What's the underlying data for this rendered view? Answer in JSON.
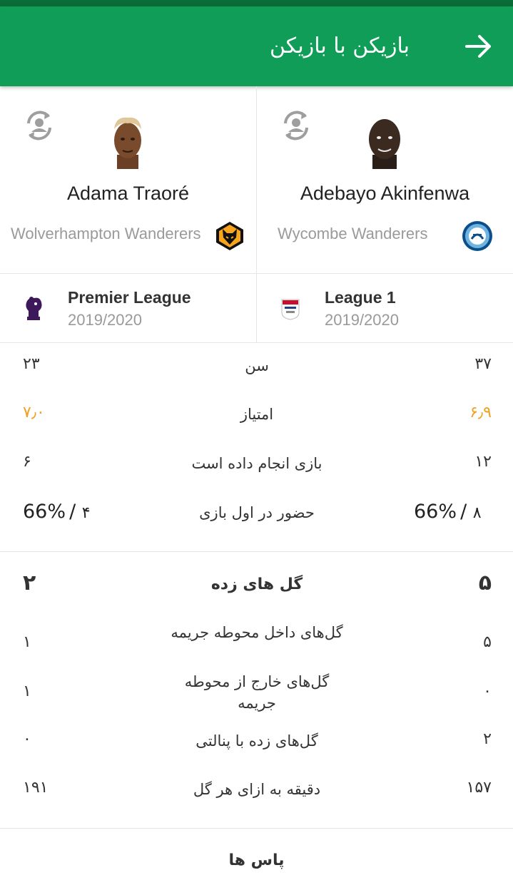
{
  "header": {
    "title": "بازیکن با بازیکن"
  },
  "players": {
    "left": {
      "name": "Adama Traoré",
      "team": "Wolverhampton Wanderers",
      "league": "Premier League",
      "season": "2019/2020"
    },
    "right": {
      "name": "Adebayo Akinfenwa",
      "team": "Wycombe Wanderers",
      "league": "League 1",
      "season": "2019/2020"
    }
  },
  "stats": [
    {
      "label": "سن",
      "left": "۲۳",
      "right": "۳۷"
    },
    {
      "label": "امتیاز",
      "left": "۷٫۰",
      "right": "۶٫۹"
    },
    {
      "label": "بازی انجام داده است",
      "left": "۶",
      "right": "۱۲"
    },
    {
      "label": "حضور در اول بازی",
      "left_count": "۴",
      "left_pct": "66%",
      "right_count": "۸",
      "right_pct": "66%"
    }
  ],
  "goals": {
    "title": {
      "label": "گل های زده",
      "left": "۲",
      "right": "۵"
    },
    "rows": [
      {
        "label": "گل‌های داخل محوطه جریمه",
        "left": "۱",
        "right": "۵"
      },
      {
        "label": "گل‌های خارج از محوطه جریمه",
        "left": "۱",
        "right": "۰"
      },
      {
        "label": "گل‌های زده با پنالتی",
        "left": "۰",
        "right": "۲"
      },
      {
        "label": "دقیقه به ازای هر گل",
        "left": "۱۹۱",
        "right": "۱۵۷"
      }
    ]
  },
  "passes": {
    "title": "پاس ها"
  },
  "colors": {
    "header": "#0f9d58",
    "status": "#0b6b37",
    "rating": "#f0a020"
  }
}
